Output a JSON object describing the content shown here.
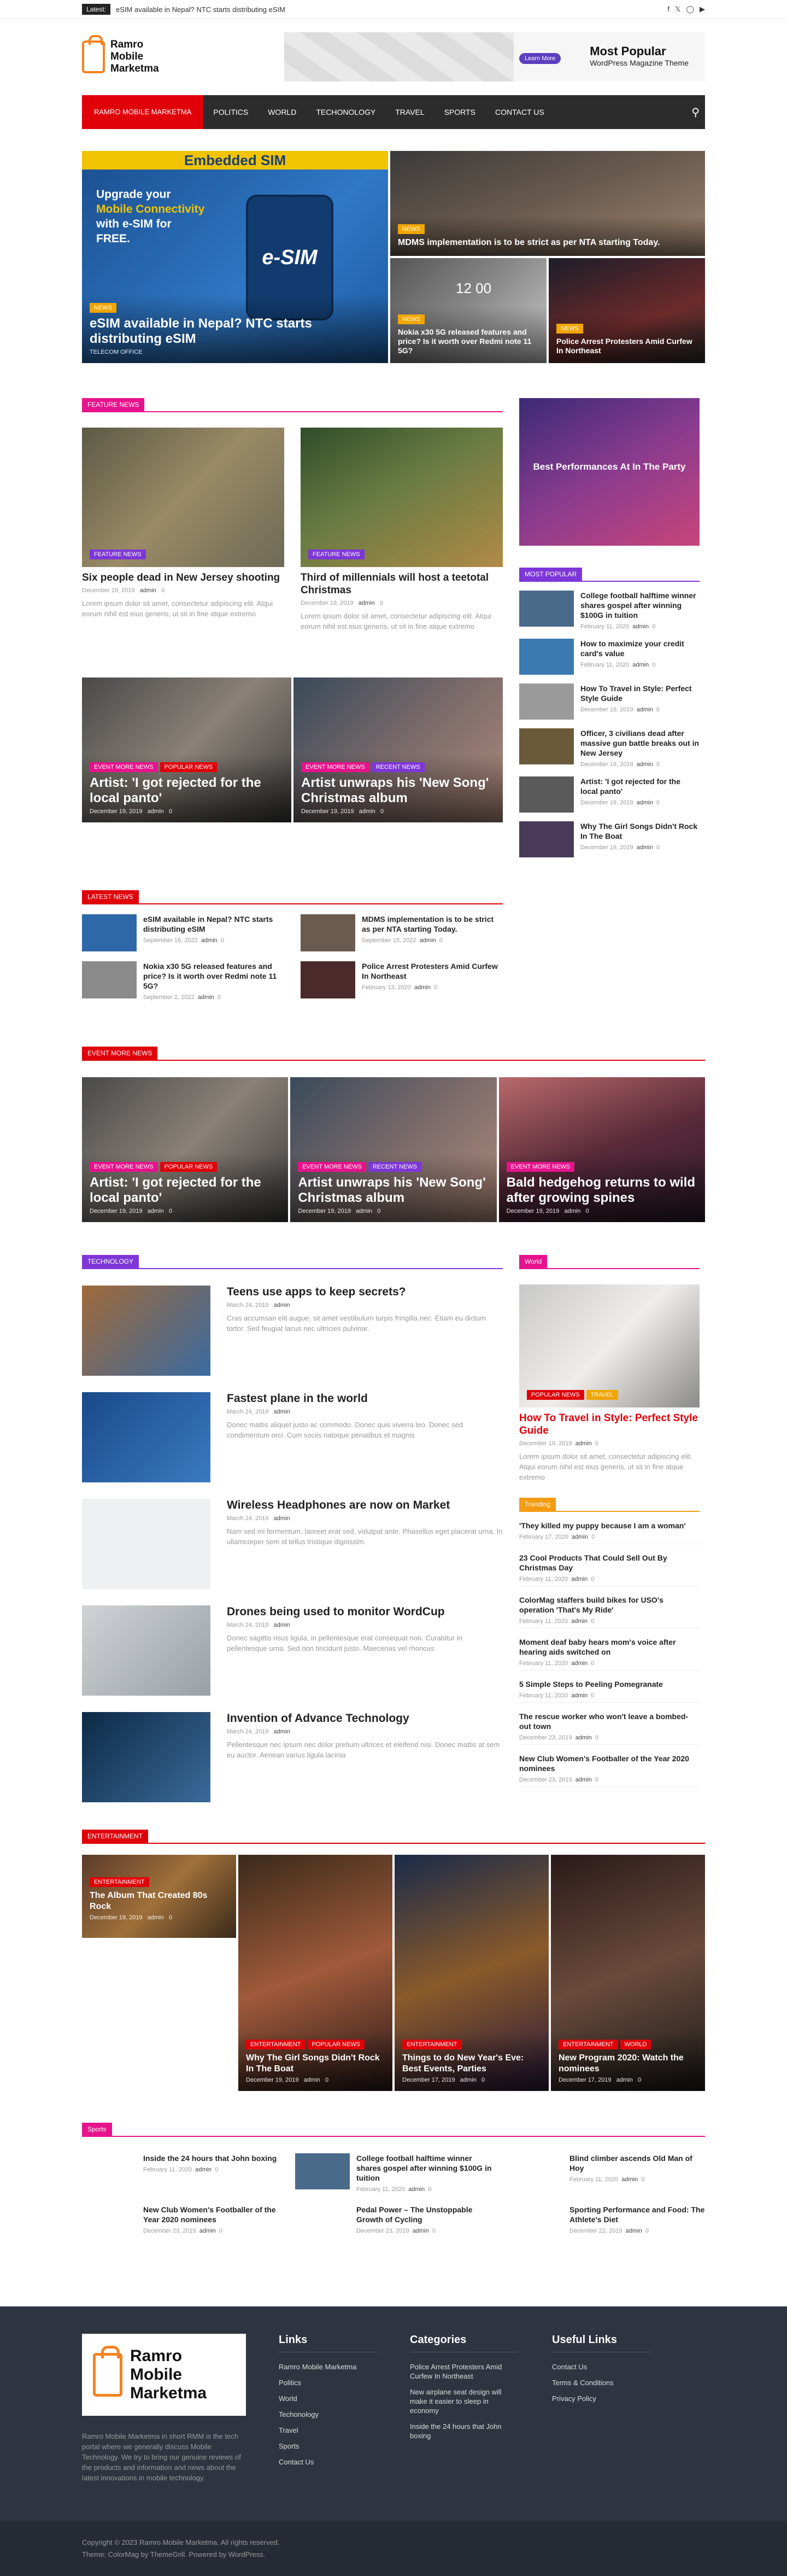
{
  "topbar": {
    "latest_label": "Latest:",
    "latest_text": "eSIM available in Nepal? NTC starts distributing eSIM"
  },
  "header": {
    "site_name_1": "Ramro",
    "site_name_2": "Mobile",
    "site_name_3": "Marketma"
  },
  "ad": {
    "button": "Learn More",
    "title": "Most Popular",
    "subtitle": "WordPress Magazine Theme"
  },
  "nav": {
    "home": "RAMRO MOBILE MARKETMA",
    "items": [
      "POLITICS",
      "WORLD",
      "TECHONOLOGY",
      "TRAVEL",
      "SPORTS",
      "CONTACT US"
    ]
  },
  "hero": {
    "main": {
      "banner": "Embedded SIM",
      "line1": "Upgrade your",
      "line2": "Mobile Connectivity",
      "line3": "with e-SIM for",
      "line4": "FREE.",
      "card": "e-SIM",
      "tag": "NEWS",
      "title": "eSIM available in Nepal? NTC starts distributing eSIM",
      "footer": "TELECOM OFFICE"
    },
    "top": {
      "tag": "NEWS",
      "title": "MDMS implementation is to be strict as per NTA starting Today."
    },
    "b1": {
      "tag": "NEWS",
      "title": "Nokia x30 5G released features and price? Is it worth over Redmi note 11 5G?",
      "clock": "12 00"
    },
    "b2": {
      "tag": "NEWS",
      "title": "Police Arrest Protesters Amid Curfew In Northeast"
    }
  },
  "feature": {
    "label": "FEATURE NEWS",
    "cards": [
      {
        "tag": "FEATURE NEWS",
        "title": "Six people dead in New Jersey shooting",
        "date": "December 19, 2019",
        "author": "admin",
        "comments": "0",
        "excerpt": "Lorem ipsum dolor sit amet, consectetur adipiscing elit. Atqui eorum nihil est eius generis, ut sit in fine atque extremo"
      },
      {
        "tag": "FEATURE NEWS",
        "title": "Third of millennials will host a teetotal Christmas",
        "date": "December 19, 2019",
        "author": "admin",
        "comments": "0",
        "excerpt": "Lorem ipsum dolor sit amet, consectetur adipiscing elit. Atqui eorum nihil est eius generis, ut sit in fine atque extremo"
      }
    ],
    "wide": [
      {
        "tag1": "EVENT MORE NEWS",
        "tag2": "POPULAR NEWS",
        "title": "Artist: 'I got rejected for the local panto'",
        "date": "December 19, 2019",
        "author": "admin",
        "comments": "0"
      },
      {
        "tag1": "EVENT MORE NEWS",
        "tag2": "RECENT NEWS",
        "title": "Artist unwraps his 'New Song' Christmas album",
        "date": "December 19, 2019",
        "author": "admin",
        "comments": "0"
      }
    ]
  },
  "side_promo": {
    "title": "Best Performances At In The Party"
  },
  "most_popular": {
    "label": "MOST POPULAR",
    "items": [
      {
        "title": "College football halftime winner shares gospel after winning $100G in tuition",
        "date": "February 11, 2020",
        "author": "admin",
        "comments": "0"
      },
      {
        "title": "How to maximize your credit card's value",
        "date": "February 11, 2020",
        "author": "admin",
        "comments": "0"
      },
      {
        "title": "How To Travel in Style: Perfect Style Guide",
        "date": "December 19, 2019",
        "author": "admin",
        "comments": "0"
      },
      {
        "title": "Officer, 3 civilians dead after massive gun battle breaks out in New Jersey",
        "date": "December 19, 2019",
        "author": "admin",
        "comments": "0"
      },
      {
        "title": "Artist: 'I got rejected for the local panto'",
        "date": "December 19, 2019",
        "author": "admin",
        "comments": "0"
      },
      {
        "title": "Why The Girl Songs Didn't Rock In The Boat",
        "date": "December 19, 2019",
        "author": "admin",
        "comments": "0"
      }
    ]
  },
  "latest": {
    "label": "LATEST NEWS",
    "items": [
      {
        "title": "eSIM available in Nepal? NTC starts distributing eSIM",
        "date": "September 16, 2022",
        "author": "admin",
        "comments": "0"
      },
      {
        "title": "MDMS implementation is to be strict as per NTA starting Today.",
        "date": "September 15, 2022",
        "author": "admin",
        "comments": "0"
      },
      {
        "title": "Nokia x30 5G released features and price? Is it worth over Redmi note 11 5G?",
        "date": "September 2, 2022",
        "author": "admin",
        "comments": "0"
      },
      {
        "title": "Police Arrest Protesters Amid Curfew In Northeast",
        "date": "February 13, 2020",
        "author": "admin",
        "comments": "0"
      }
    ]
  },
  "event": {
    "label": "EVENT MORE NEWS",
    "cards": [
      {
        "tag1": "EVENT MORE NEWS",
        "tag2": "POPULAR NEWS",
        "title": "Artist: 'I got rejected for the local panto'",
        "date": "December 19, 2019",
        "author": "admin",
        "comments": "0"
      },
      {
        "tag1": "EVENT MORE NEWS",
        "tag2": "RECENT NEWS",
        "title": "Artist unwraps his 'New Song' Christmas album",
        "date": "December 19, 2019",
        "author": "admin",
        "comments": "0"
      },
      {
        "tag1": "EVENT MORE NEWS",
        "tag2": "",
        "title": "Bald hedgehog returns to wild after growing spines",
        "date": "December 19, 2019",
        "author": "admin",
        "comments": "0"
      }
    ]
  },
  "technology": {
    "label": "TECHNOLOGY",
    "items": [
      {
        "title": "Teens use apps to keep secrets?",
        "date": "March 24, 2019",
        "author": "admin",
        "excerpt": "Cras accumsan elit augue, sit amet vestibulum turpis fringilla nec. Etiam eu dictum tortor. Sed feugiat lacus nec ultricies pulvinar."
      },
      {
        "title": "Fastest plane in the world",
        "date": "March 24, 2019",
        "author": "admin",
        "excerpt": "Donec mattis aliquet justo ac commodo. Donec quis viverra leo. Donec sed condimentum orci. Cum sociis natoque penatibus et magnis"
      },
      {
        "title": "Wireless Headphones are now on Market",
        "date": "March 24, 2019",
        "author": "admin",
        "excerpt": "Nam sed mi fermentum, laoreet erat sed, volutpat ante. Phasellus eget placerat urna. In ullamcorper sem id tellus tristique dignissim."
      },
      {
        "title": "Drones being used to monitor WordCup",
        "date": "March 24, 2019",
        "author": "admin",
        "excerpt": "Donec sagittis risus ligula, in pellentesque erat consequat non. Curabitur in pellentesque urna. Sed non tincidunt justo. Maecenas vel rhoncus"
      },
      {
        "title": "Invention of Advance Technology",
        "date": "March 24, 2019",
        "author": "admin",
        "excerpt": "Pellentesque nec ipsum nec dolor pretium ultrices et eleifend nisi. Donec mattis at sem eu auctor. Aenean varius ligula lacinia"
      }
    ]
  },
  "world": {
    "label": "World",
    "tag1": "POPULAR NEWS",
    "tag2": "TRAVEL",
    "title": "How To Travel in Style: Perfect Style Guide",
    "date": "December 19, 2019",
    "author": "admin",
    "comments": "0",
    "excerpt": "Lorem ipsum dolor sit amet, consectetur adipiscing elit. Atqui eorum nihil est eius generis, ut sit in fine atque extremo"
  },
  "trending": {
    "label": "Trending",
    "items": [
      {
        "title": "'They killed my puppy because I am a woman'",
        "date": "February 17, 2020",
        "author": "admin",
        "comments": "0"
      },
      {
        "title": "23 Cool Products That Could Sell Out By Christmas Day",
        "date": "February 11, 2020",
        "author": "admin",
        "comments": "0"
      },
      {
        "title": "ColorMag staffers build bikes for USO's operation 'That's My Ride'",
        "date": "February 11, 2020",
        "author": "admin",
        "comments": "0"
      },
      {
        "title": "Moment deaf baby hears mom's voice after hearing aids switched on",
        "date": "February 11, 2020",
        "author": "admin",
        "comments": "0"
      },
      {
        "title": "5 Simple Steps to Peeling Pomegranate",
        "date": "February 11, 2020",
        "author": "admin",
        "comments": "0"
      },
      {
        "title": "The rescue worker who won't leave a bombed-out town",
        "date": "December 23, 2019",
        "author": "admin",
        "comments": "0"
      },
      {
        "title": "New Club Women's Footballer of the Year 2020 nominees",
        "date": "December 23, 2019",
        "author": "admin",
        "comments": "0"
      }
    ]
  },
  "entertainment": {
    "label": "ENTERTAINMENT",
    "cards": [
      {
        "tag1": "ENTERTAINMENT",
        "tag2": "",
        "title": "The Album That Created 80s Rock",
        "date": "December 19, 2019",
        "author": "admin",
        "comments": "0"
      },
      {
        "tag1": "ENTERTAINMENT",
        "tag2": "POPULAR NEWS",
        "title": "Why The Girl Songs Didn't Rock In The Boat",
        "date": "December 19, 2019",
        "author": "admin",
        "comments": "0"
      },
      {
        "tag1": "ENTERTAINMENT",
        "tag2": "",
        "title": "Things to do New Year's Eve: Best Events, Parties",
        "date": "December 17, 2019",
        "author": "admin",
        "comments": "0"
      },
      {
        "tag1": "ENTERTAINMENT",
        "tag2": "WORLD",
        "title": "New Program 2020: Watch the nominees",
        "date": "December 17, 2019",
        "author": "admin",
        "comments": "0"
      }
    ]
  },
  "sports": {
    "label": "Sports",
    "items": [
      {
        "title": "Inside the 24 hours that John boxing",
        "date": "February 11, 2020",
        "author": "admin",
        "comments": "0"
      },
      {
        "title": "College football halftime winner shares gospel after winning $100G in tuition",
        "date": "February 11, 2020",
        "author": "admin",
        "comments": "0"
      },
      {
        "title": "Blind climber ascends Old Man of Hoy",
        "date": "February 11, 2020",
        "author": "admin",
        "comments": "0"
      },
      {
        "title": "New Club Women's Footballer of the Year 2020 nominees",
        "date": "December 23, 2019",
        "author": "admin",
        "comments": "0"
      },
      {
        "title": "Pedal Power – The Unstoppable Growth of Cycling",
        "date": "December 23, 2019",
        "author": "admin",
        "comments": "0"
      },
      {
        "title": "Sporting Performance and Food: The Athlete's Diet",
        "date": "December 22, 2019",
        "author": "admin",
        "comments": "0"
      }
    ]
  },
  "footer": {
    "name_1": "Ramro",
    "name_2": "Mobile",
    "name_3": "Marketma",
    "desc": "Ramro Mobile Marketma in short RMM is the tech portal where we generally discuss Mobile Technology. We try to bring our genuine reviews of the products and information and news about the latest innovations in mobile technology.",
    "links_head": "Links",
    "links": [
      "Ramro Mobile Marketma",
      "Politics",
      "World",
      "Techonology",
      "Travel",
      "Sports",
      "Contact Us"
    ],
    "cats_head": "Categories",
    "cats": [
      "Police Arrest Protesters Amid Curfew In Northeast",
      "New airplane seat design will make it easier to sleep in economy",
      "Inside the 24 hours that John boxing"
    ],
    "useful_head": "Useful Links",
    "useful": [
      "Contact Us",
      "Terms & Conditions",
      "Privacy Policy"
    ]
  },
  "copyright": {
    "line1": "Copyright © 2023 Ramro Mobile Marketma. All rights reserved.",
    "line2": "Theme: ColorMag by ThemeGrill. Powered by WordPress."
  }
}
